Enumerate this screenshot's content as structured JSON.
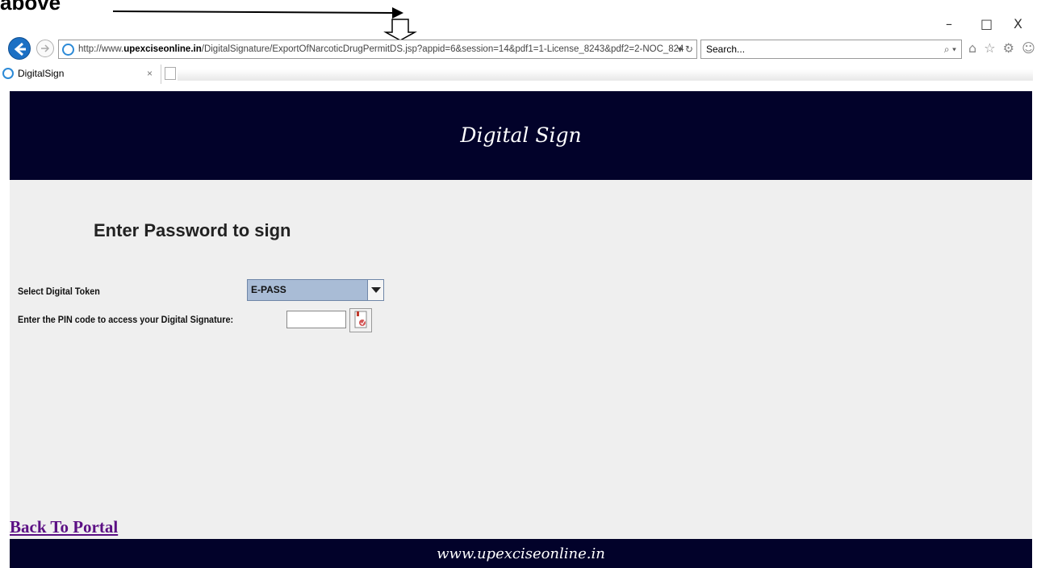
{
  "annotation": {
    "label": "above"
  },
  "window": {
    "minimize": "–",
    "restore": "□",
    "close": "X"
  },
  "browser": {
    "url_prefix": "http://www.",
    "url_domain": "upexciseonline.in",
    "url_rest": "/DigitalSignature/ExportOfNarcoticDrugPermitDS.jsp?appid=6&session=14&pdf1=1-License_8243&pdf2=2-NOC_824",
    "url_tools": "▾ ↻",
    "search_placeholder": "Search...",
    "search_icon": "⌕ ▾",
    "toolbar_icons": "⌂ ☆ ⚙ ☺",
    "tab_title": "DigitalSign",
    "tab_close": "×"
  },
  "page": {
    "header_title": "Digital Sign",
    "heading": "Enter Password to sign",
    "token_label": "Select Digital Token",
    "token_value": "E-PASS",
    "pin_label": "Enter the PIN code to access your Digital Signature:",
    "pin_value": "",
    "back_link": "Back To Portal",
    "footer_text": "www.upexciseonline.in"
  }
}
